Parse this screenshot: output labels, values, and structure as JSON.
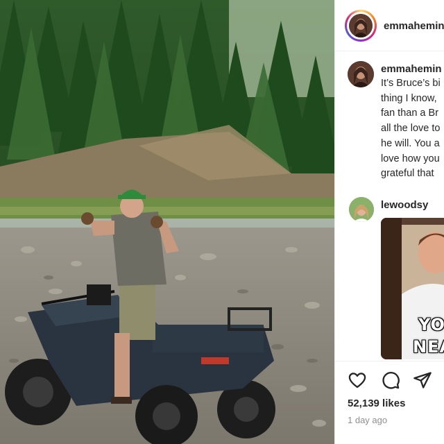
{
  "post": {
    "author": "emmahemin",
    "caption_lines": [
      "It’s Bruce’s bi",
      "thing I know,",
      "fan than a Br",
      "all the love to",
      "he will. You a",
      "love how you",
      "grateful that"
    ]
  },
  "comments": [
    {
      "username": "lewoodsy",
      "gif_text_lines": [
        "YO",
        "NEA"
      ]
    }
  ],
  "actions": {
    "icons": [
      "heart-icon",
      "comment-icon",
      "share-icon"
    ]
  },
  "stats": {
    "likes": "52,139 likes",
    "time_ago": "1 day ago"
  },
  "colors": {
    "text": "#262626",
    "secondary_text": "#8e8e8e",
    "divider": "#efefef",
    "story_ring": [
      "#feda75",
      "#fa7e1e",
      "#d62976",
      "#962fbf",
      "#4f5bd5"
    ]
  }
}
